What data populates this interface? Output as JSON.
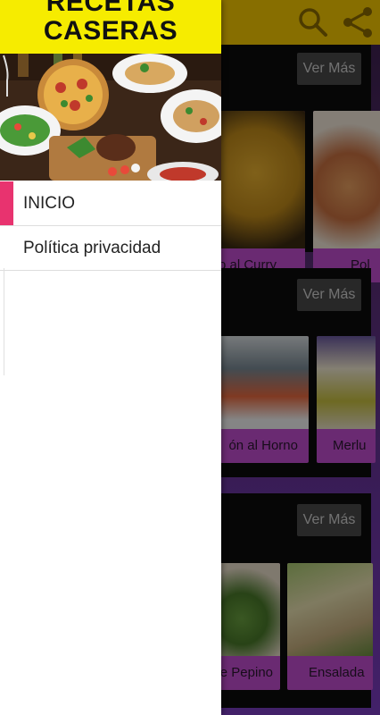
{
  "drawer": {
    "title_line1": "RECETAS",
    "title_line2": "CASERAS",
    "menu": [
      {
        "label": "INICIO",
        "active": true
      },
      {
        "label": "Política privacidad",
        "active": false
      }
    ],
    "accent_color": "#e8336f",
    "title_bg": "#f6ec00"
  },
  "appbar": {
    "bg": "#f6c800",
    "actions": [
      "search-icon",
      "share-icon"
    ]
  },
  "sections": [
    {
      "more_label": "Ver Más",
      "cards": [
        {
          "caption": "o al Curry"
        },
        {
          "caption": "Pol"
        }
      ]
    },
    {
      "more_label": "Ver Más",
      "cards": [
        {
          "caption": "ón al Horno"
        },
        {
          "caption": "Merlu"
        }
      ]
    },
    {
      "more_label": "Ver Más",
      "cards": [
        {
          "caption": "e Pepino"
        },
        {
          "caption": "Ensalada"
        }
      ]
    }
  ]
}
